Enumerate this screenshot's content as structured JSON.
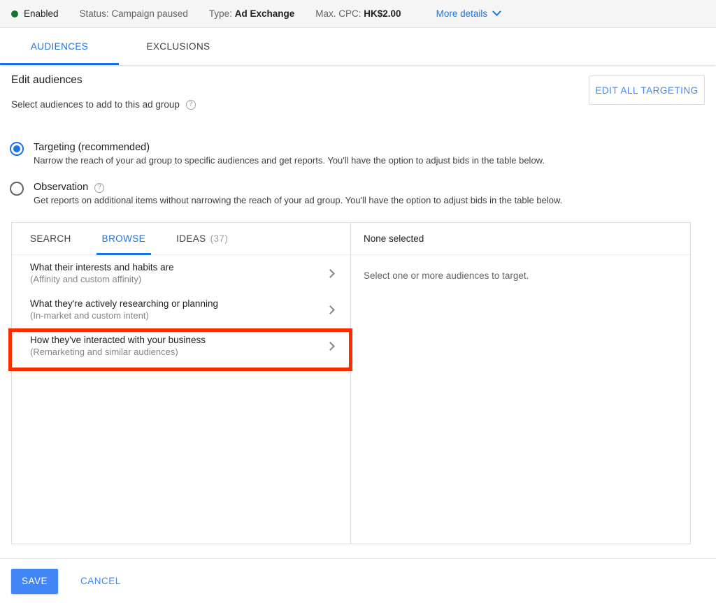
{
  "statusbar": {
    "enabled_label": "Enabled",
    "status_prefix": "Status:",
    "status_value": "Campaign paused",
    "type_prefix": "Type:",
    "type_value": "Ad Exchange",
    "cpc_prefix": "Max. CPC:",
    "cpc_value": "HK$2.00",
    "more_details_label": "More details",
    "enabled_dot_color": "#137333",
    "link_color": "#1a73e8"
  },
  "tabs": [
    {
      "label": "AUDIENCES",
      "active": true
    },
    {
      "label": "EXCLUSIONS",
      "active": false
    }
  ],
  "header": {
    "title": "Edit audiences",
    "subtitle": "Select audiences to add to this ad group",
    "help_glyph": "?",
    "edit_all_targeting_label": "EDIT ALL TARGETING"
  },
  "options": [
    {
      "label": "Targeting (recommended)",
      "description": "Narrow the reach of your ad group to specific audiences and get reports. You'll have the option to adjust bids in the table below.",
      "selected": true,
      "has_help": false
    },
    {
      "label": "Observation",
      "description": "Get reports on additional items without narrowing the reach of your ad group. You'll have the option to adjust bids in the table below.",
      "selected": false,
      "has_help": true
    }
  ],
  "panel": {
    "tabs": [
      {
        "label": "SEARCH",
        "count": "",
        "active": false
      },
      {
        "label": "BROWSE",
        "count": "",
        "active": true
      },
      {
        "label": "IDEAS",
        "count": "(37)",
        "active": false
      }
    ],
    "browse_rows": [
      {
        "title": "What their interests and habits are",
        "subtitle": "(Affinity and custom affinity)",
        "highlighted": false
      },
      {
        "title": "What they're actively researching or planning",
        "subtitle": "(In-market and custom intent)",
        "highlighted": false
      },
      {
        "title": "How they've interacted with your business",
        "subtitle": "(Remarketing and similar audiences)",
        "highlighted": true
      }
    ],
    "selection_header": "None selected",
    "selection_empty_text": "Select one or more audiences to target."
  },
  "footer": {
    "save_label": "SAVE",
    "cancel_label": "CANCEL",
    "save_color": "#4285f4"
  },
  "annotation": {
    "color": "#fb2c00",
    "target": "How they've interacted with your business"
  }
}
